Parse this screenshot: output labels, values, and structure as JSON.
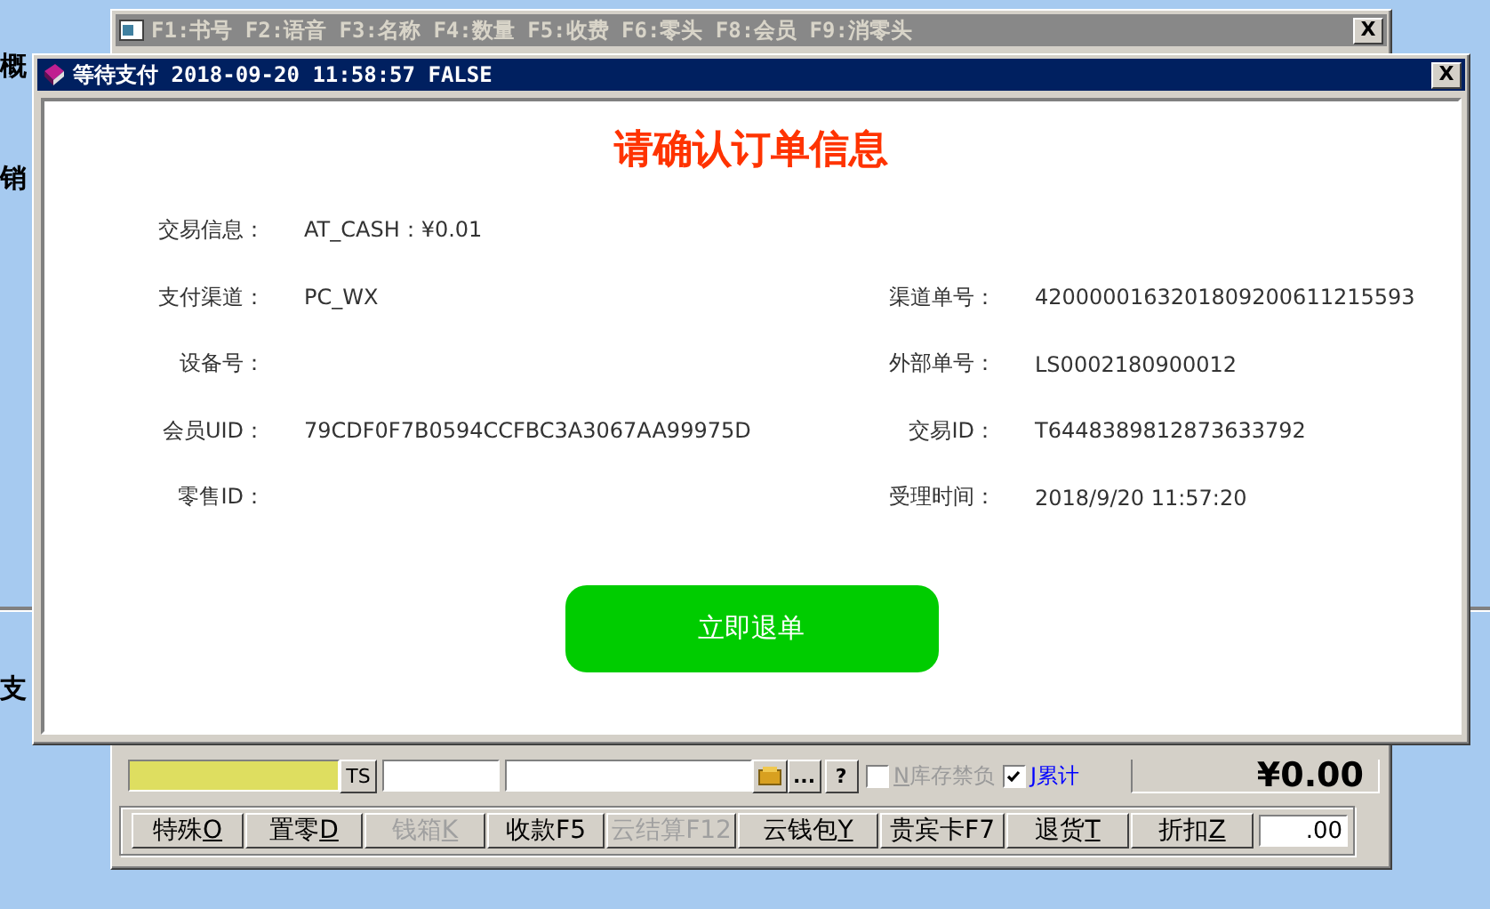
{
  "desktop_texts": [
    "概",
    "销",
    "支"
  ],
  "back_window": {
    "title": "F1:书号 F2:语音 F3:名称 F4:数量 F5:收费 F6:零头 F8:会员 F9:消零头",
    "close": "X",
    "toolbar": {
      "ts_button": "TS",
      "more_button": "...",
      "help_button": "?",
      "checkboxes": [
        {
          "hotkey": "N",
          "label": "库存禁负",
          "checked": false,
          "disabled": true
        },
        {
          "hotkey": "J",
          "label": "累计",
          "checked": true,
          "disabled": false
        }
      ]
    },
    "total": "¥0.00",
    "buttons": [
      {
        "label": "特殊",
        "hotkey": "O",
        "disabled": false
      },
      {
        "label": "置零",
        "hotkey": "D",
        "disabled": false
      },
      {
        "label": "钱箱",
        "hotkey": "K",
        "disabled": true
      },
      {
        "label": "收款F5",
        "disabled": false
      },
      {
        "label": "云结算F12",
        "disabled": true
      },
      {
        "label": "云钱包",
        "hotkey": "Y",
        "disabled": false
      },
      {
        "label": "贵宾卡F7",
        "disabled": false
      },
      {
        "label": "退货",
        "hotkey": "T",
        "disabled": false
      },
      {
        "label": "折扣",
        "hotkey": "Z",
        "disabled": false
      }
    ],
    "discount_value": ".00"
  },
  "dialog": {
    "title": "等待支付 2018-09-20 11:58:57 FALSE",
    "close": "X",
    "heading": "请确认订单信息",
    "rows": [
      {
        "left": {
          "label": "交易信息：",
          "value": "AT_CASH：¥0.01"
        }
      },
      {
        "left": {
          "label": "支付渠道：",
          "value": "PC_WX"
        },
        "right": {
          "label": "渠道单号：",
          "value": "4200000163201809200611215593"
        }
      },
      {
        "left": {
          "label": "设备号："
        },
        "right": {
          "label": "外部单号：",
          "value": "LS0002180900012"
        }
      },
      {
        "left": {
          "label": "会员UID：",
          "value": "79CDF0F7B0594CCFBC3A3067AA99975D"
        },
        "right": {
          "label": "交易ID：",
          "value": "T6448389812873633792"
        }
      },
      {
        "left": {
          "label": "零售ID："
        },
        "right": {
          "label": "受理时间：",
          "value": "2018/9/20 11:57:20"
        }
      }
    ],
    "refund_button": "立即退单"
  }
}
